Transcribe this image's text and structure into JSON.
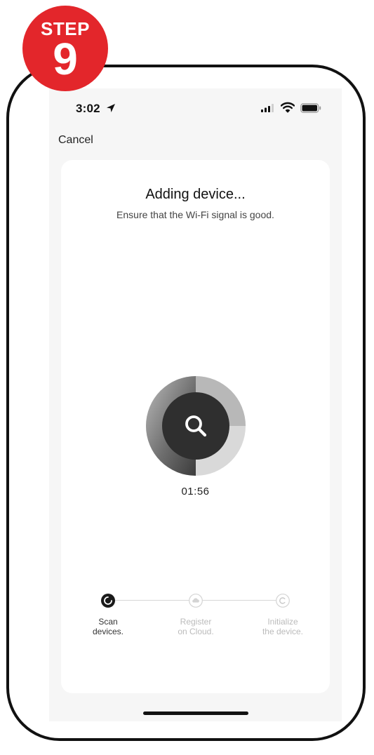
{
  "badge": {
    "label": "STEP",
    "number": "9",
    "color": "#e3262b"
  },
  "status_bar": {
    "time": "3:02",
    "icons": [
      "location-arrow-icon",
      "signal-icon",
      "wifi-icon",
      "battery-icon"
    ]
  },
  "nav": {
    "cancel_label": "Cancel"
  },
  "main": {
    "title": "Adding device...",
    "subtitle": "Ensure that the Wi-Fi signal is good.",
    "progress_icon": "search-icon",
    "timer": "01:56"
  },
  "steps": [
    {
      "line1": "Scan",
      "line2": "devices.",
      "state": "active",
      "icon": "loading-icon"
    },
    {
      "line1": "Register",
      "line2": "on Cloud.",
      "state": "pending",
      "icon": "cloud-icon"
    },
    {
      "line1": "Initialize",
      "line2": "the device.",
      "state": "pending",
      "icon": "init-icon"
    }
  ],
  "colors": {
    "screen_bg": "#f6f6f6",
    "card_bg": "#ffffff",
    "active_text": "#333333",
    "inactive_text": "#bbbbbb"
  }
}
